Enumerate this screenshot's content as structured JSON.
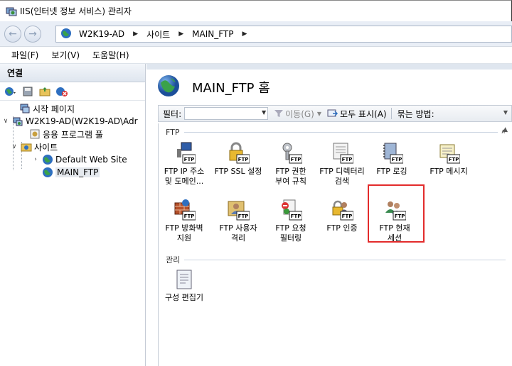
{
  "window": {
    "title": "IIS(인터넷 정보 서비스) 관리자"
  },
  "address": {
    "crumbs": [
      "W2K19-AD",
      "사이트",
      "MAIN_FTP"
    ]
  },
  "menu": [
    "파일(F)",
    "보기(V)",
    "도움말(H)"
  ],
  "connections": {
    "header": "연결",
    "tree": [
      {
        "label": "시작 페이지",
        "icon": "start-page-icon"
      },
      {
        "label": "W2K19-AD(W2K19-AD\\Adr",
        "icon": "server-icon",
        "toggle": "v"
      },
      {
        "label": "응용 프로그램 풀",
        "icon": "app-pool-icon"
      },
      {
        "label": "사이트",
        "icon": "sites-folder-icon",
        "toggle": "v"
      },
      {
        "label": "Default Web Site",
        "icon": "globe-icon",
        "toggle": ">"
      },
      {
        "label": "MAIN_FTP",
        "icon": "globe-icon"
      }
    ]
  },
  "page": {
    "title": "MAIN_FTP 홈"
  },
  "filterbar": {
    "filter_label": "필터:",
    "go_label": "이동(G)",
    "show_all_label": "모두 표시(A)",
    "group_by_label": "묶는 방법:"
  },
  "groups": {
    "ftp": {
      "label": "FTP",
      "items": [
        {
          "label": "FTP IP 주소 및 도메인...",
          "icon": "ftp-ip-icon"
        },
        {
          "label": "FTP SSL 설정",
          "icon": "ftp-ssl-lock-icon"
        },
        {
          "label": "FTP 권한 부여 규칙",
          "icon": "ftp-key-icon"
        },
        {
          "label": "FTP 디렉터리 검색",
          "icon": "ftp-directory-icon"
        },
        {
          "label": "FTP 로깅",
          "icon": "ftp-log-icon"
        },
        {
          "label": "FTP 메시지",
          "icon": "ftp-message-icon"
        },
        {
          "label": "FTP 방화벽 지원",
          "icon": "ftp-firewall-icon"
        },
        {
          "label": "FTP 사용자 격리",
          "icon": "ftp-user-isolation-icon"
        },
        {
          "label": "FTP 요청 필터링",
          "icon": "ftp-request-filter-icon"
        },
        {
          "label": "FTP 인증",
          "icon": "ftp-auth-icon"
        },
        {
          "label": "FTP 현재 세션",
          "icon": "ftp-current-sessions-icon"
        }
      ]
    },
    "manage": {
      "label": "관리",
      "items": [
        {
          "label": "구성 편집기",
          "icon": "config-editor-icon"
        }
      ]
    }
  },
  "colors": {
    "accent": "#e32b2b",
    "panel_header": "#dfe6ef"
  }
}
